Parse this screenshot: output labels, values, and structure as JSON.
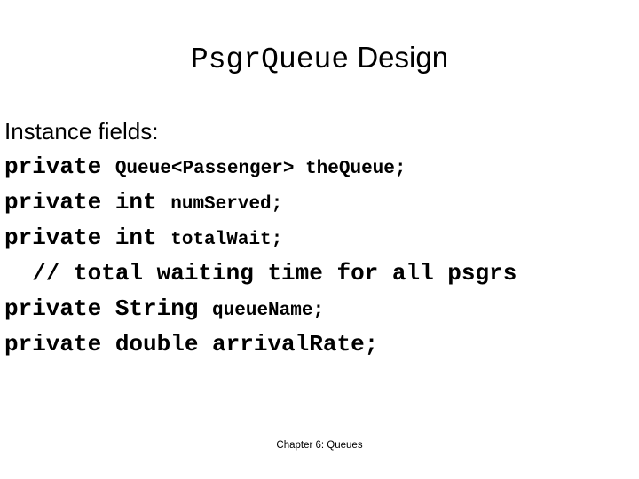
{
  "slide": {
    "title": {
      "mono_part": "PsgrQueue",
      "space": " ",
      "sans_part": "Design"
    },
    "heading": "Instance fields:",
    "code_lines": [
      {
        "name": "field-thequeue",
        "large": "private ",
        "small": "Queue<Passenger> theQueue;"
      },
      {
        "name": "field-numserved",
        "large": "private int ",
        "small": "numServed;"
      },
      {
        "name": "field-totalwait",
        "large": "private int ",
        "small": "totalWait;"
      },
      {
        "name": "comment-totalwait",
        "large": "  // total waiting time for all psgrs",
        "small": ""
      },
      {
        "name": "field-queuename",
        "large": "private String ",
        "small": "queueName;"
      },
      {
        "name": "field-arrivalrate",
        "large": "private double arrivalRate;",
        "small": ""
      }
    ],
    "footer": "Chapter 6: Queues"
  }
}
